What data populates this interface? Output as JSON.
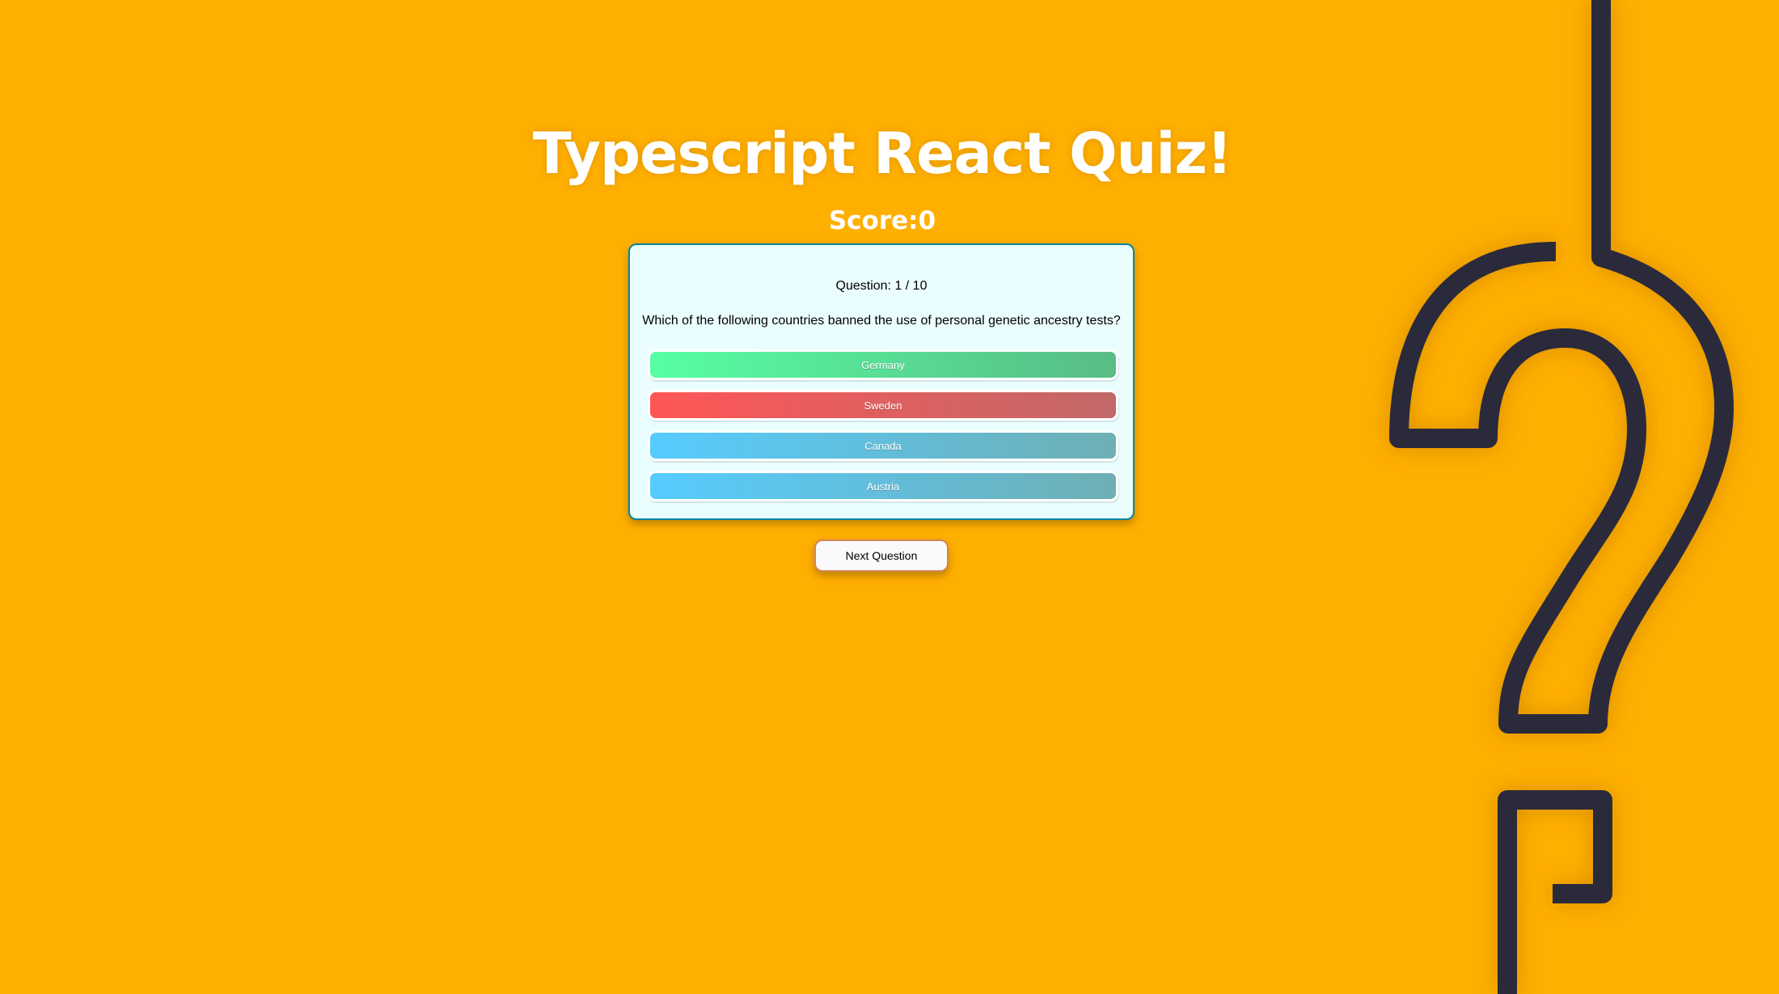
{
  "app": {
    "title": "Typescript React Quiz!",
    "score": "Score:0"
  },
  "question": {
    "number": "Question: 1 / 10",
    "text": "Which of the following countries banned the use of personal genetic ancestry tests?"
  },
  "answers": [
    {
      "label": "Germany",
      "state": "correct"
    },
    {
      "label": "Sweden",
      "state": "wrong"
    },
    {
      "label": "Canada",
      "state": "neutral"
    },
    {
      "label": "Austria",
      "state": "neutral"
    }
  ],
  "controls": {
    "next_label": "Next Question"
  },
  "colors": {
    "background": "#FFAF00",
    "decoration": "#2A2B3A",
    "card_background": "#EBFEFF",
    "card_border": "#0085A3",
    "correct": "#56FFA4",
    "wrong": "#FF5656",
    "neutral": "#56CCFF"
  },
  "decoration": {
    "icon": "question-mark-icon"
  }
}
